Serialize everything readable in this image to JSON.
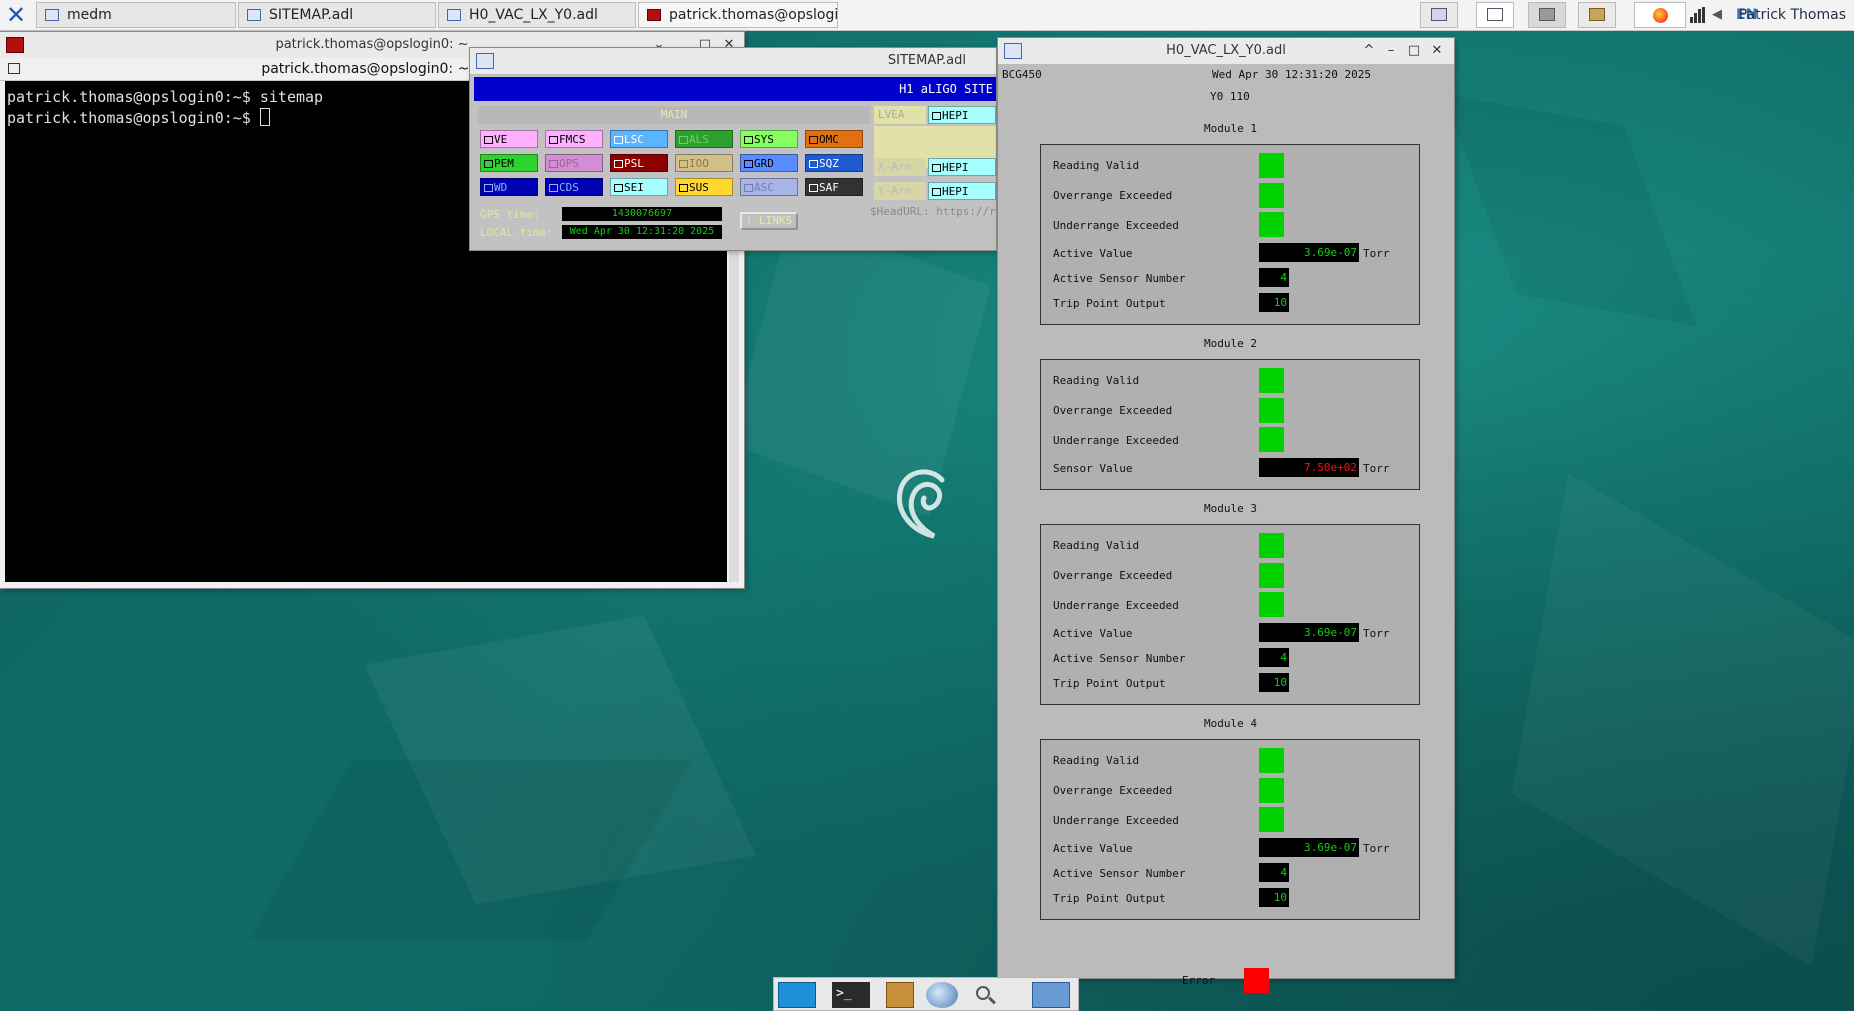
{
  "taskbar": {
    "tasks": [
      {
        "label": "medm"
      },
      {
        "label": "SITEMAP.adl"
      },
      {
        "label": "H0_VAC_LX_Y0.adl"
      },
      {
        "label": "patrick.thomas@opslogin..."
      }
    ],
    "lang": "EN",
    "user": "Patrick Thomas"
  },
  "terminal": {
    "title": "patrick.thomas@opslogin0: ~",
    "subtitle": "patrick.thomas@opslogin0: ~ 8",
    "lines": [
      "patrick.thomas@opslogin0:~$ sitemap",
      "patrick.thomas@opslogin0:~$ "
    ]
  },
  "sitemap": {
    "title": "SITEMAP.adl",
    "banner": "H1 aLIGO SITE",
    "main_label": "MAIN",
    "lvea_label": "LVEA",
    "xarm_label": "X-Arm",
    "yarm_label": "Y-Arm",
    "hepi_labels": [
      "HEPI",
      "HEPI",
      "HEPI"
    ],
    "buttons_row1": [
      "VE",
      "FMCS",
      "LSC",
      "ALS",
      "SYS",
      "OMC"
    ],
    "buttons_row2": [
      "PEM",
      "OPS",
      "PSL",
      "IOO",
      "GRD",
      "SQZ"
    ],
    "buttons_row3": [
      "WD",
      "CDS",
      "SEI",
      "SUS",
      "ASC",
      "SAF"
    ],
    "gps_label": "GPS time:",
    "gps_value": "1430076697",
    "local_label": "LOCAL time:",
    "local_value": "Wed Apr 30 12:31:20 2025",
    "links_label": "! LINKS",
    "headurl": "$HeadURL: https://red"
  },
  "vac": {
    "title": "H0_VAC_LX_Y0.adl",
    "device": "BCG450",
    "datetime": "Wed Apr 30 12:31:20 2025",
    "location": "Y0 110",
    "unit": "Torr",
    "modules": [
      {
        "name": "Module 1",
        "rows": [
          {
            "label": "Reading Valid"
          },
          {
            "label": "Overrange Exceeded"
          },
          {
            "label": "Underrange Exceeded"
          },
          {
            "label": "Active Value",
            "value": "3.69e-07"
          },
          {
            "label": "Active Sensor Number",
            "value": "4"
          },
          {
            "label": "Trip Point Output",
            "value": "10"
          }
        ]
      },
      {
        "name": "Module 2",
        "rows": [
          {
            "label": "Reading Valid"
          },
          {
            "label": "Overrange Exceeded"
          },
          {
            "label": "Underrange Exceeded"
          },
          {
            "label": "Sensor Value",
            "value": "7.50e+02"
          }
        ]
      },
      {
        "name": "Module 3",
        "rows": [
          {
            "label": "Reading Valid"
          },
          {
            "label": "Overrange Exceeded"
          },
          {
            "label": "Underrange Exceeded"
          },
          {
            "label": "Active Value",
            "value": "3.69e-07"
          },
          {
            "label": "Active Sensor Number",
            "value": "4"
          },
          {
            "label": "Trip Point Output",
            "value": "10"
          }
        ]
      },
      {
        "name": "Module 4",
        "rows": [
          {
            "label": "Reading Valid"
          },
          {
            "label": "Overrange Exceeded"
          },
          {
            "label": "Underrange Exceeded"
          },
          {
            "label": "Active Value",
            "value": "3.69e-07"
          },
          {
            "label": "Active Sensor Number",
            "value": "4"
          },
          {
            "label": "Trip Point Output",
            "value": "10"
          }
        ]
      }
    ],
    "error_label": "Error"
  },
  "colors": {
    "ok": "#00d200",
    "error": "#ff0000",
    "readback": "#10d010",
    "alarm_text": "#ff1010",
    "sitemap_banner": "#0000cc"
  },
  "icons": {
    "logo": "xfce-logo-icon",
    "desktop": "debian-swirl-icon"
  }
}
